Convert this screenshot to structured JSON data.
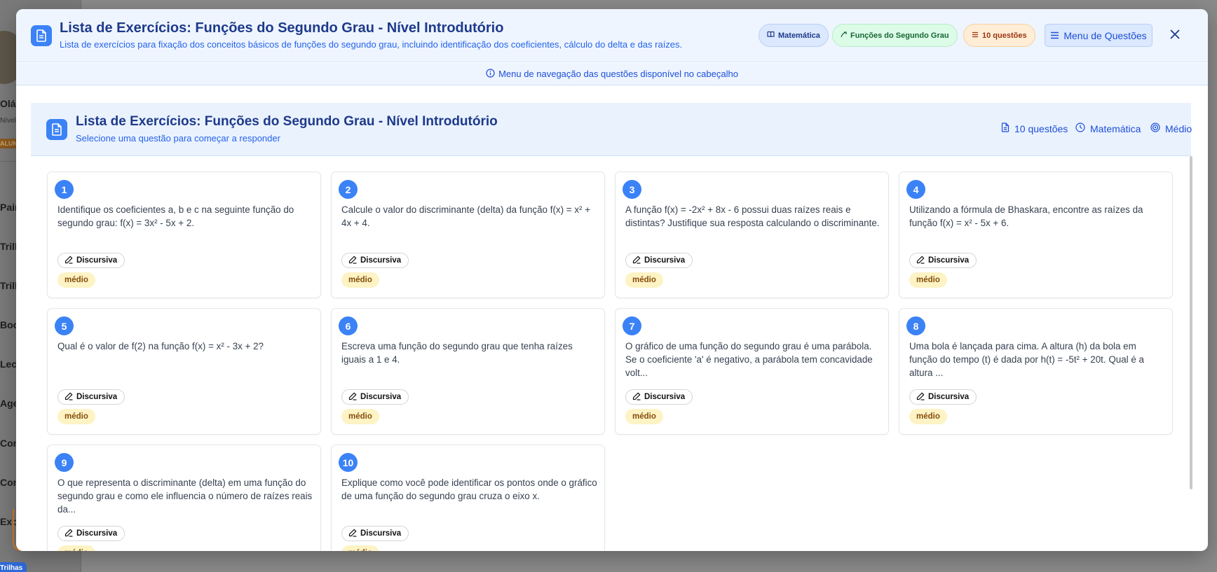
{
  "background": {
    "greeting": "Olá,",
    "level": "Nível",
    "badge": "ALUNO",
    "nav_items": [
      "Painel",
      "Trilhas",
      "Trilhas",
      "Books",
      "Lectus",
      "Agenda",
      "Comunidade",
      "Conquistas",
      "Explorar"
    ],
    "chip": "Trilhas"
  },
  "modal": {
    "title": "Lista de Exercícios: Funções do Segundo Grau - Nível Introdutório",
    "subtitle": "Lista de exercícios para fixação dos conceitos básicos de funções do segundo grau, incluindo identificação dos coeficientes, cálculo do delta e das raízes.",
    "pills": {
      "subject": "Matemática",
      "topic": "Funções do Segundo Grau",
      "count": "10 questões"
    },
    "menu_button": "Menu de Questões",
    "info_bar": "Menu de navegação das questões disponível no cabeçalho",
    "colors": {
      "accent": "#3b82f6",
      "title": "#1e3a8a",
      "level_bg": "#fdf3c4"
    }
  },
  "list": {
    "title": "Lista de Exercícios: Funções do Segundo Grau - Nível Introdutório",
    "subtitle": "Selecione uma questão para começar a responder",
    "stats": {
      "questions": "10 questões",
      "subject": "Matemática",
      "difficulty": "Médio"
    }
  },
  "questions": [
    {
      "number": "1",
      "text": "Identifique os coeficientes a, b e c na seguinte função do segundo grau: f(x) = 3x² - 5x + 2.",
      "type": "Discursiva",
      "level": "médio"
    },
    {
      "number": "2",
      "text": "Calcule o valor do discriminante (delta) da função f(x) = x² + 4x + 4.",
      "type": "Discursiva",
      "level": "médio"
    },
    {
      "number": "3",
      "text": "A função f(x) = -2x² + 8x - 6 possui duas raízes reais e distintas? Justifique sua resposta calculando o discriminante.",
      "type": "Discursiva",
      "level": "médio"
    },
    {
      "number": "4",
      "text": "Utilizando a fórmula de Bhaskara, encontre as raízes da função f(x) = x² - 5x + 6.",
      "type": "Discursiva",
      "level": "médio"
    },
    {
      "number": "5",
      "text": "Qual é o valor de f(2) na função f(x) = x² - 3x + 2?",
      "type": "Discursiva",
      "level": "médio"
    },
    {
      "number": "6",
      "text": "Escreva uma função do segundo grau que tenha raízes iguais a 1 e 4.",
      "type": "Discursiva",
      "level": "médio"
    },
    {
      "number": "7",
      "text": "O gráfico de uma função do segundo grau é uma parábola. Se o coeficiente 'a' é negativo, a parábola tem concavidade volt...",
      "type": "Discursiva",
      "level": "médio"
    },
    {
      "number": "8",
      "text": "Uma bola é lançada para cima. A altura (h) da bola em função do tempo (t) é dada por h(t) = -5t² + 20t. Qual é a altura ...",
      "type": "Discursiva",
      "level": "médio"
    },
    {
      "number": "9",
      "text": "O que representa o discriminante (delta) em uma função do segundo grau e como ele influencia o número de raízes reais da...",
      "type": "Discursiva",
      "level": "médio"
    },
    {
      "number": "10",
      "text": "Explique como você pode identificar os pontos onde o gráfico de uma função do segundo grau cruza o eixo x.",
      "type": "Discursiva",
      "level": "médio"
    }
  ]
}
